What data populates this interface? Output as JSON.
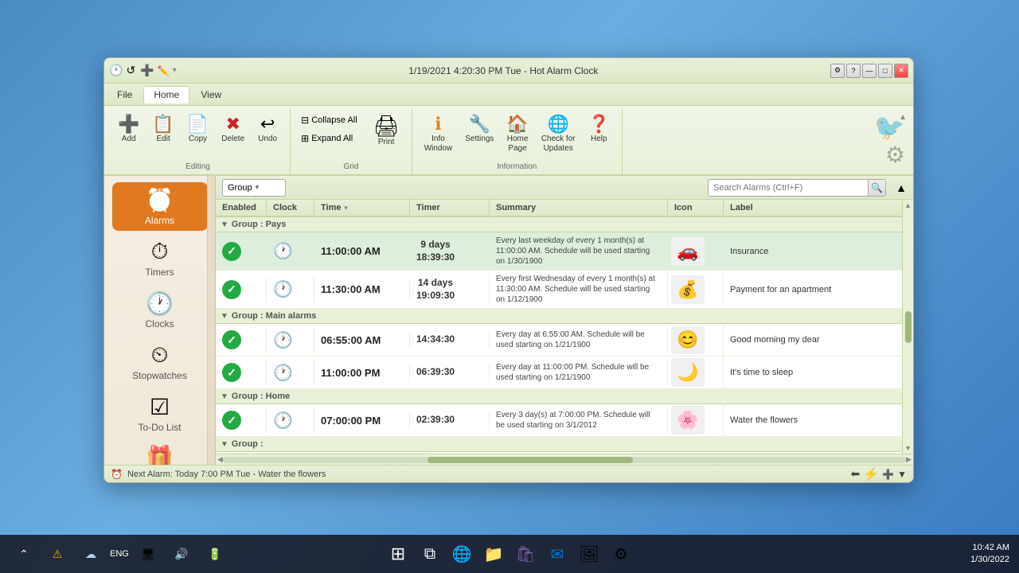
{
  "window": {
    "title": "1/19/2021 4:20:30 PM Tue - Hot Alarm Clock",
    "minimize_btn": "—",
    "maximize_btn": "□",
    "close_btn": "✕"
  },
  "menu": {
    "items": [
      "File",
      "Home",
      "View"
    ],
    "active": "Home"
  },
  "ribbon": {
    "editing_group": "Editing",
    "grid_group": "Grid",
    "information_group": "Information",
    "buttons": {
      "add": "Add",
      "edit": "Edit",
      "copy": "Copy",
      "delete": "Delete",
      "undo": "Undo",
      "collapse_all": "Collapse All",
      "expand_all": "Expand All",
      "print": "Print",
      "info_window": "Info\nWindow",
      "settings": "Settings",
      "home_page": "Home\nPage",
      "check_updates": "Check for\nUpdates",
      "help": "Help"
    }
  },
  "toolbar": {
    "group_label": "Group",
    "search_placeholder": "Search Alarms (Ctrl+F)"
  },
  "table": {
    "columns": [
      "Enabled",
      "Clock",
      "Time",
      "Timer",
      "Summary",
      "Icon",
      "Label"
    ],
    "groups": [
      {
        "name": "Group : Pays",
        "expanded": true,
        "alarms": [
          {
            "enabled": true,
            "time": "11:00:00 AM",
            "timer": "9 days\n18:39:30",
            "summary": "Every last weekday of every 1 month(s) at 11:00:00 AM. Schedule will be used starting on 1/30/1900",
            "icon": "🚗",
            "label": "Insurance"
          },
          {
            "enabled": true,
            "time": "11:30:00 AM",
            "timer": "14 days\n19:09:30",
            "summary": "Every first Wednesday of every 1 month(s) at 11:30:00 AM. Schedule will be used starting on 1/12/1900",
            "icon": "💰",
            "label": "Payment for an apartment"
          }
        ]
      },
      {
        "name": "Group : Main alarms",
        "expanded": true,
        "alarms": [
          {
            "enabled": true,
            "time": "06:55:00 AM",
            "timer": "14:34:30",
            "summary": "Every day at 6:55:00 AM. Schedule will be used starting on 1/21/1900",
            "icon": "😊",
            "label": "Good morning my dear"
          },
          {
            "enabled": true,
            "time": "11:00:00 PM",
            "timer": "06:39:30",
            "summary": "Every day at 11:00:00 PM. Schedule will be used starting on 1/21/1900",
            "icon": "🌙",
            "label": "It's time to sleep"
          }
        ]
      },
      {
        "name": "Group : Home",
        "expanded": true,
        "alarms": [
          {
            "enabled": true,
            "time": "07:00:00 PM",
            "timer": "02:39:30",
            "summary": "Every 3 day(s) at 7:00:00 PM. Schedule will be used starting on 3/1/2012",
            "icon": "🌸",
            "label": "Water the flowers"
          }
        ]
      },
      {
        "name": "Group :",
        "expanded": true,
        "alarms": []
      }
    ]
  },
  "sidebar": {
    "items": [
      {
        "label": "Alarms",
        "icon": "⏰",
        "active": true
      },
      {
        "label": "Timers",
        "icon": "⏱️",
        "active": false
      },
      {
        "label": "Clocks",
        "icon": "🕐",
        "active": false
      },
      {
        "label": "Stopwatches",
        "icon": "⏲️",
        "active": false
      },
      {
        "label": "To-Do List",
        "icon": "✅",
        "active": false
      }
    ]
  },
  "status_bar": {
    "text": "Next Alarm: Today 7:00 PM Tue - Water the flowers"
  },
  "taskbar": {
    "time": "10:42 AM",
    "date": "1/30/2022",
    "language": "ENG"
  }
}
